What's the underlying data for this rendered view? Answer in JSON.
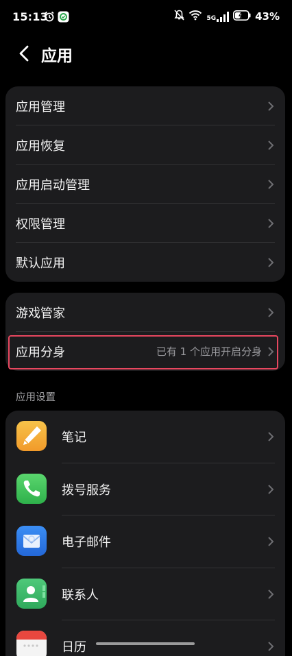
{
  "status_bar": {
    "time": "15:13",
    "network": "5G",
    "battery_percent": "43%",
    "left_icons": [
      "alarm-icon",
      "app-notification-icon"
    ],
    "right_icons": [
      "mute-icon",
      "wifi-icon",
      "signal-icon",
      "battery-icon"
    ]
  },
  "header": {
    "back_icon": "chevron-left-icon",
    "title": "应用"
  },
  "group1": {
    "items": [
      {
        "label": "应用管理"
      },
      {
        "label": "应用恢复"
      },
      {
        "label": "应用启动管理"
      },
      {
        "label": "权限管理"
      },
      {
        "label": "默认应用"
      }
    ]
  },
  "group2": {
    "items": [
      {
        "label": "游戏管家",
        "value": ""
      },
      {
        "label": "应用分身",
        "value": "已有 1 个应用开启分身",
        "highlighted": true
      }
    ]
  },
  "app_settings": {
    "section_title": "应用设置",
    "items": [
      {
        "label": "笔记",
        "icon": "notes-icon"
      },
      {
        "label": "拨号服务",
        "icon": "phone-icon"
      },
      {
        "label": "电子邮件",
        "icon": "email-icon"
      },
      {
        "label": "联系人",
        "icon": "contacts-icon"
      },
      {
        "label": "日历",
        "icon": "calendar-icon"
      }
    ]
  },
  "colors": {
    "background": "#000000",
    "card": "#1c1c1e",
    "highlight_border": "#e8475f",
    "secondary_text": "#9a9a9e"
  }
}
